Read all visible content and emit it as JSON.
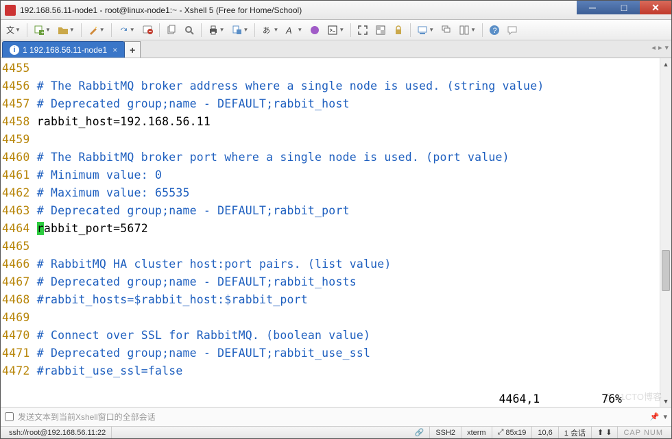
{
  "window": {
    "title": "192.168.56.11-node1 - root@linux-node1:~ - Xshell 5 (Free for Home/School)"
  },
  "tabs": {
    "active_label": "1 192.168.56.11-node1",
    "nav_left": "◂",
    "nav_right": "▸",
    "nav_menu": "▾"
  },
  "toolbar": {
    "menu_label": "文"
  },
  "terminal": {
    "lines": [
      {
        "num": "4455",
        "segments": []
      },
      {
        "num": "4456",
        "segments": [
          {
            "cls": "txt-comment",
            "t": "# The RabbitMQ broker address where a single node is used. (string value)"
          }
        ]
      },
      {
        "num": "4457",
        "segments": [
          {
            "cls": "txt-comment",
            "t": "# Deprecated group;name - DEFAULT;rabbit_host"
          }
        ]
      },
      {
        "num": "4458",
        "segments": [
          {
            "cls": "txt-plain",
            "t": "rabbit_host=192.168.56.11"
          }
        ]
      },
      {
        "num": "4459",
        "segments": []
      },
      {
        "num": "4460",
        "segments": [
          {
            "cls": "txt-comment",
            "t": "# The RabbitMQ broker port where a single node is used. (port value)"
          }
        ]
      },
      {
        "num": "4461",
        "segments": [
          {
            "cls": "txt-comment",
            "t": "# Minimum value: 0"
          }
        ]
      },
      {
        "num": "4462",
        "segments": [
          {
            "cls": "txt-comment",
            "t": "# Maximum value: 65535"
          }
        ]
      },
      {
        "num": "4463",
        "segments": [
          {
            "cls": "txt-comment",
            "t": "# Deprecated group;name - DEFAULT;rabbit_port"
          }
        ]
      },
      {
        "num": "4464",
        "segments": [
          {
            "cls": "cursor-hl",
            "t": "r"
          },
          {
            "cls": "txt-plain",
            "t": "abbit_port=5672"
          }
        ]
      },
      {
        "num": "4465",
        "segments": []
      },
      {
        "num": "4466",
        "segments": [
          {
            "cls": "txt-comment",
            "t": "# RabbitMQ HA cluster host:port pairs. (list value)"
          }
        ]
      },
      {
        "num": "4467",
        "segments": [
          {
            "cls": "txt-comment",
            "t": "# Deprecated group;name - DEFAULT;rabbit_hosts"
          }
        ]
      },
      {
        "num": "4468",
        "segments": [
          {
            "cls": "txt-comment",
            "t": "#rabbit_hosts=$rabbit_host:$rabbit_port"
          }
        ]
      },
      {
        "num": "4469",
        "segments": []
      },
      {
        "num": "4470",
        "segments": [
          {
            "cls": "txt-comment",
            "t": "# Connect over SSL for RabbitMQ. (boolean value)"
          }
        ]
      },
      {
        "num": "4471",
        "segments": [
          {
            "cls": "txt-comment",
            "t": "# Deprecated group;name - DEFAULT;rabbit_use_ssl"
          }
        ]
      },
      {
        "num": "4472",
        "segments": [
          {
            "cls": "txt-comment",
            "t": "#rabbit_use_ssl=false"
          }
        ]
      }
    ],
    "vim_pos": "4464,1",
    "vim_pct": "76%"
  },
  "sendbar": {
    "hint": "发送文本到当前Xshell窗口的全部会话"
  },
  "status": {
    "conn": "ssh://root@192.168.56.11:22",
    "proto": "SSH2",
    "term": "xterm",
    "size": "85x19",
    "rc": "10,6",
    "sess": "1 会话",
    "caps": "CAP  NUM",
    "arrows": "⬆ ⬇"
  },
  "watermark": "@ 51CTO博客"
}
